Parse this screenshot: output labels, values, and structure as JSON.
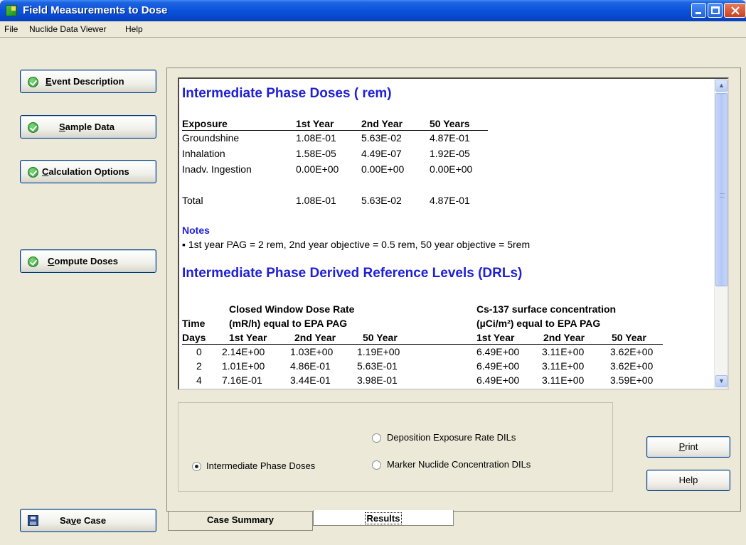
{
  "window": {
    "title": "Field Measurements to Dose"
  },
  "menu": [
    "File",
    "Nuclide Data Viewer",
    "Help"
  ],
  "left_buttons": {
    "event": {
      "pre": "",
      "acc": "E",
      "post": "vent Description"
    },
    "sample": {
      "pre": "",
      "acc": "S",
      "post": "ample Data"
    },
    "calc": {
      "pre": "",
      "acc": "C",
      "post": "alculation Options"
    },
    "compute": {
      "pre": "",
      "acc": "C",
      "post": "ompute Doses"
    },
    "save": {
      "pre": "Sa",
      "acc": "v",
      "post": "e Case"
    }
  },
  "report": {
    "title": "Intermediate Phase Doses ( rem)",
    "dose_table": {
      "headers": [
        "Exposure",
        "1st Year",
        "2nd Year",
        "50 Years"
      ],
      "rows": [
        [
          "Groundshine",
          "1.08E-01",
          "5.63E-02",
          "4.87E-01"
        ],
        [
          "Inhalation",
          "1.58E-05",
          "4.49E-07",
          "1.92E-05"
        ],
        [
          "Inadv. Ingestion",
          "0.00E+00",
          "0.00E+00",
          "0.00E+00"
        ]
      ],
      "total": [
        "Total",
        "1.08E-01",
        "5.63E-02",
        "4.87E-01"
      ]
    },
    "notes_title": "Notes",
    "notes_text": "▪ 1st year PAG = 2 rem, 2nd year objective = 0.5 rem, 50 year objective = 5rem",
    "drl_title": "Intermediate Phase Derived Reference Levels (DRLs)",
    "drl_table": {
      "group1_line1": "Closed Window Dose Rate",
      "group1_line2": "(mR/h) equal to EPA PAG",
      "group2_line1": "Cs-137  surface concentration",
      "group2_line2": "(µCi/m²) equal to EPA PAG",
      "time_label": "Time",
      "days_label": "Days",
      "sub_headers": [
        "1st Year",
        "2nd Year",
        "50 Year"
      ],
      "rows": [
        [
          "0",
          "2.14E+00",
          "1.03E+00",
          "1.19E+00",
          "6.49E+00",
          "3.11E+00",
          "3.62E+00"
        ],
        [
          "2",
          "1.01E+00",
          "4.86E-01",
          "5.63E-01",
          "6.49E+00",
          "3.11E+00",
          "3.62E+00"
        ],
        [
          "4",
          "7.16E-01",
          "3.44E-01",
          "3.98E-01",
          "6.49E+00",
          "3.11E+00",
          "3.59E+00"
        ]
      ]
    }
  },
  "options": {
    "deposition": "Deposition Exposure Rate DILs",
    "intermediate": "Intermediate Phase Doses",
    "marker": "Marker Nuclide Concentration DILs",
    "selected": "Intermediate Phase Doses"
  },
  "buttons": {
    "print": {
      "acc": "P",
      "post": "rint"
    },
    "help": "Help"
  },
  "tabs": [
    "Case Summary",
    "Results"
  ]
}
